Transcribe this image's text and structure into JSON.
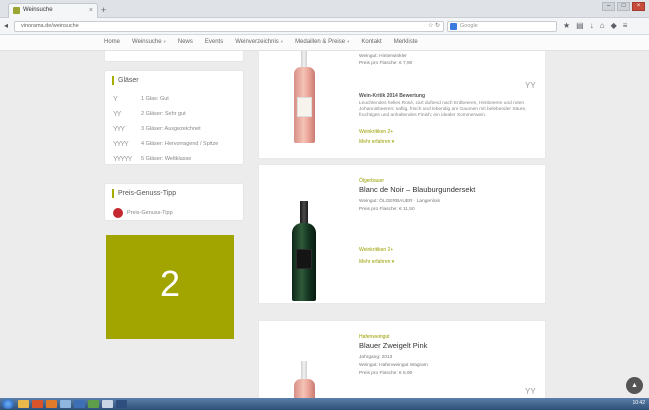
{
  "browser": {
    "tab_title": "Weinsuche",
    "url": "vinorama.de/weinsuche",
    "search_placeholder": "Google",
    "colors": {
      "accent": "#a6ad00",
      "tab_favicon": "#9aa631"
    }
  },
  "menu": {
    "items": [
      {
        "label": "Home",
        "caret": ""
      },
      {
        "label": "Weinsuche",
        "caret": "▾"
      },
      {
        "label": "News",
        "caret": ""
      },
      {
        "label": "Events",
        "caret": ""
      },
      {
        "label": "Weinverzeichnis",
        "caret": "▾"
      },
      {
        "label": "Medaillen & Preise",
        "caret": "▾"
      },
      {
        "label": "Kontakt",
        "caret": ""
      },
      {
        "label": "Merkliste",
        "caret": ""
      }
    ]
  },
  "sidebar": {
    "glaeser": {
      "title": "Gläser",
      "items": [
        {
          "icon": "Y",
          "label": "1 Glas: Gut"
        },
        {
          "icon": "YY",
          "label": "2 Gläser: Sehr gut"
        },
        {
          "icon": "YYY",
          "label": "3 Gläser: Ausgezeichnet"
        },
        {
          "icon": "YYYY",
          "label": "4 Gläser: Hervorragend / Spitze"
        },
        {
          "icon": "YYYYY",
          "label": "5 Gläser: Weltklasse"
        }
      ]
    },
    "preis_genuss": {
      "title": "Preis-Genuss-Tipp",
      "item_label": "Preis-Genuss-Tipp"
    },
    "banner_text": "2"
  },
  "products": [
    {
      "weingut_line": "Weingut: Hinterwinkler",
      "price_line": "Preis pro Flasche: € 7,90",
      "review_head": "Wein-Kritik 2014 Bewertung",
      "review_text": "Leuchtendes helles Rosé, zart duftend nach Erdbeeren, Himbeeren und roten Johannisbeeren; saftig, frisch und lebendig am Gaumen mit belebender Säure, fruchtiges und anhaltendes Finish; ein idealer Sommerwein.",
      "link1": "Weinkritiken 2+",
      "link2": "Mehr erfahren ▾",
      "glass_icon": "YY"
    },
    {
      "sub": "Ölgerbauer",
      "name": "Blanc de Noir – Blauburgundersekt",
      "weingut_line": "Weingut: ÖLGERBAUER · Langenlois",
      "price_line": "Preis pro Flasche: € 11,50",
      "link1": "Weinkritiken 2+",
      "link2": "Mehr erfahren ▾"
    },
    {
      "sub": "Hafenweingut",
      "name": "Blauer Zweigelt Pink",
      "year_line": "Jahrgang: 2013",
      "weingut_line": "Weingut: Hafenweingut Wagram",
      "price_line": "Preis pro Flasche: € 6,90",
      "glass_icon": "YY"
    }
  ],
  "taskbar": {
    "clock": "10:42"
  }
}
